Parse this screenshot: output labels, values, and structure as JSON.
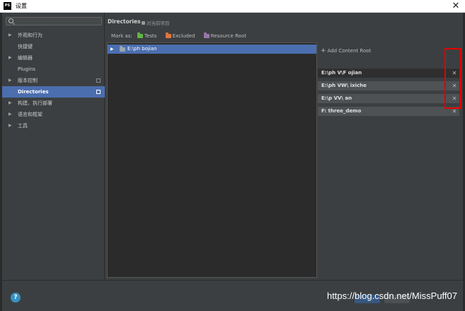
{
  "window": {
    "title": "设置",
    "app_badge": "PS"
  },
  "search": {
    "placeholder": ""
  },
  "sidebar": {
    "items": [
      {
        "label": "外观和行为",
        "expandable": true
      },
      {
        "label": "快捷键",
        "expandable": false
      },
      {
        "label": "编辑器",
        "expandable": true
      },
      {
        "label": "Plugins",
        "expandable": false
      },
      {
        "label": "版本控制",
        "expandable": true
      },
      {
        "label": "Directories",
        "expandable": false,
        "selected": true
      },
      {
        "label": "构建、执行部署",
        "expandable": true
      },
      {
        "label": "语言和框架",
        "expandable": true
      },
      {
        "label": "工具",
        "expandable": true
      }
    ]
  },
  "main": {
    "heading": "Directories",
    "scope": "对当前项目",
    "mark_as": {
      "label": "Mark as:",
      "tests": "Tests",
      "excluded": "Excluded",
      "resource_root": "Resource Root"
    },
    "tree_root": "E:\\ph                              bojian",
    "add_content_root": "Add Content Root",
    "content_roots": [
      "E:\\ph                  V\\F          ojian",
      "E:\\ph                  VW\\          ixiche",
      "E:\\p                  VV\\           an",
      "F:            three_demo"
    ]
  },
  "footer": {
    "watermark": "https://blog.csdn.net/MissPuff07"
  },
  "colors": {
    "accent": "#4b6eaf",
    "tests_folder": "#62b543",
    "excluded_folder": "#e0743e",
    "resource_folder": "#9876aa",
    "highlight": "#e60000"
  }
}
